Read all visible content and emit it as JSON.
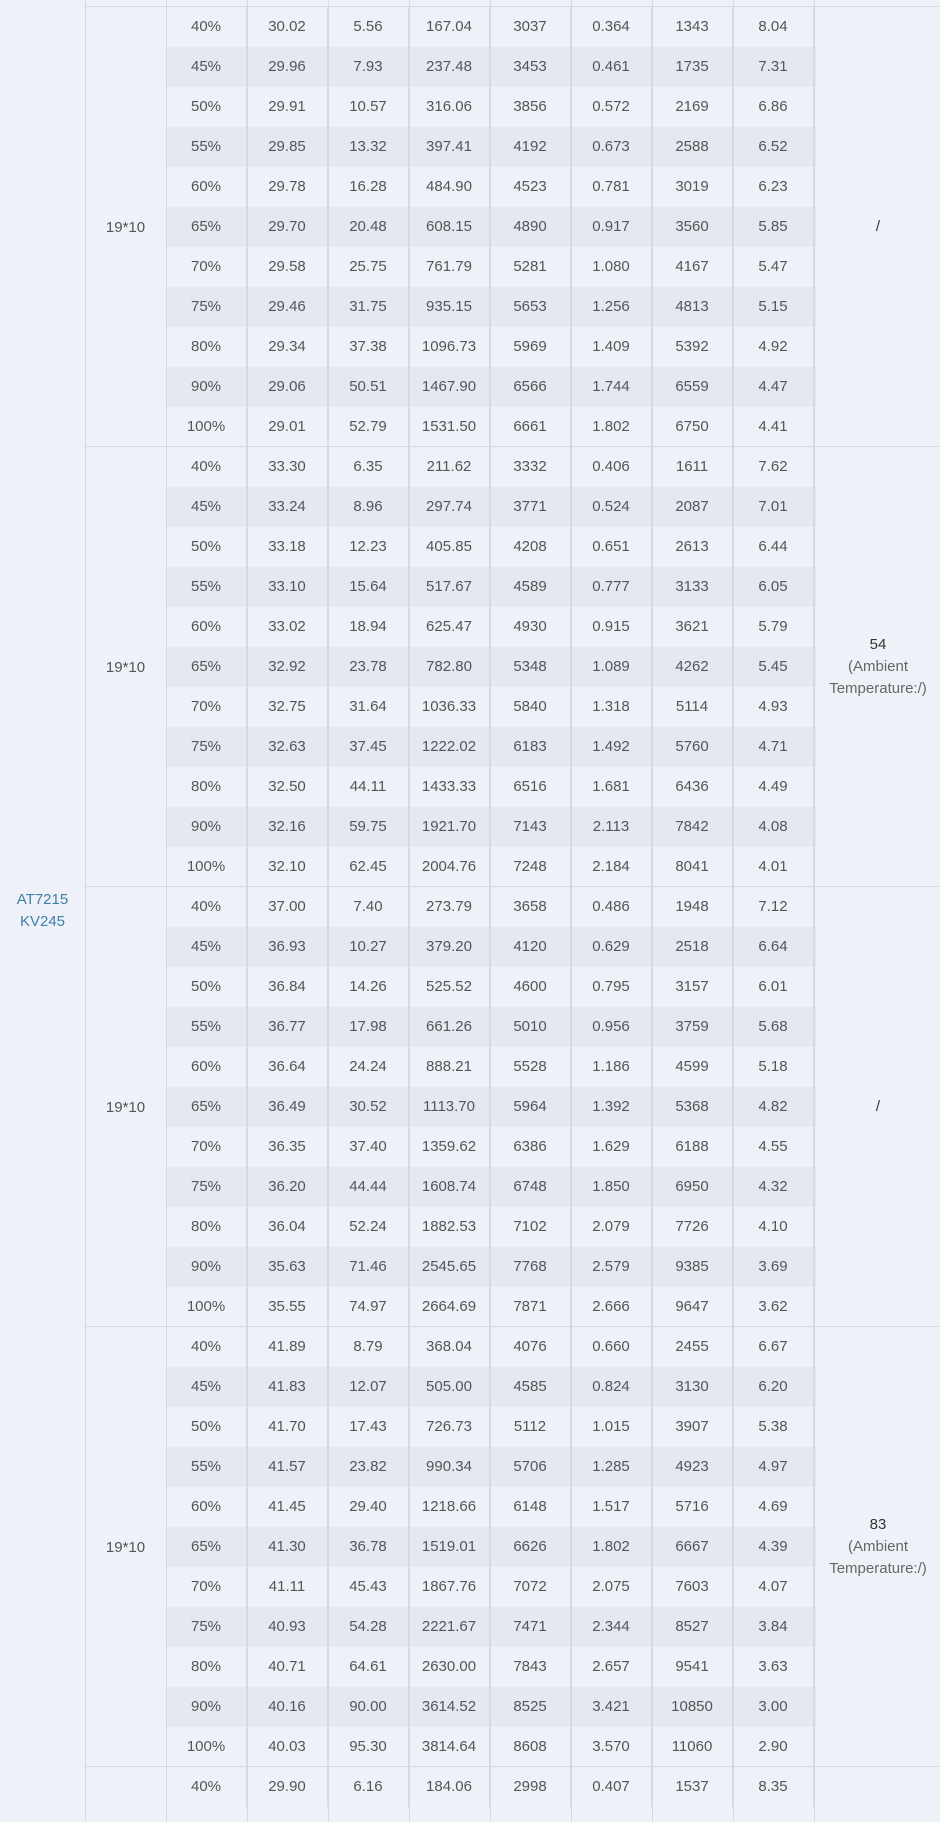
{
  "model": {
    "line1": "AT7215",
    "line2": "KV245"
  },
  "groups": [
    {
      "size": "19*10",
      "note": {
        "value": "/",
        "sub": ""
      },
      "rows": [
        [
          "40%",
          "30.02",
          "5.56",
          "167.04",
          "3037",
          "0.364",
          "1343",
          "8.04"
        ],
        [
          "45%",
          "29.96",
          "7.93",
          "237.48",
          "3453",
          "0.461",
          "1735",
          "7.31"
        ],
        [
          "50%",
          "29.91",
          "10.57",
          "316.06",
          "3856",
          "0.572",
          "2169",
          "6.86"
        ],
        [
          "55%",
          "29.85",
          "13.32",
          "397.41",
          "4192",
          "0.673",
          "2588",
          "6.52"
        ],
        [
          "60%",
          "29.78",
          "16.28",
          "484.90",
          "4523",
          "0.781",
          "3019",
          "6.23"
        ],
        [
          "65%",
          "29.70",
          "20.48",
          "608.15",
          "4890",
          "0.917",
          "3560",
          "5.85"
        ],
        [
          "70%",
          "29.58",
          "25.75",
          "761.79",
          "5281",
          "1.080",
          "4167",
          "5.47"
        ],
        [
          "75%",
          "29.46",
          "31.75",
          "935.15",
          "5653",
          "1.256",
          "4813",
          "5.15"
        ],
        [
          "80%",
          "29.34",
          "37.38",
          "1096.73",
          "5969",
          "1.409",
          "5392",
          "4.92"
        ],
        [
          "90%",
          "29.06",
          "50.51",
          "1467.90",
          "6566",
          "1.744",
          "6559",
          "4.47"
        ],
        [
          "100%",
          "29.01",
          "52.79",
          "1531.50",
          "6661",
          "1.802",
          "6750",
          "4.41"
        ]
      ]
    },
    {
      "size": "19*10",
      "note": {
        "value": "54",
        "sub": "(Ambient Temperature:/)"
      },
      "rows": [
        [
          "40%",
          "33.30",
          "6.35",
          "211.62",
          "3332",
          "0.406",
          "1611",
          "7.62"
        ],
        [
          "45%",
          "33.24",
          "8.96",
          "297.74",
          "3771",
          "0.524",
          "2087",
          "7.01"
        ],
        [
          "50%",
          "33.18",
          "12.23",
          "405.85",
          "4208",
          "0.651",
          "2613",
          "6.44"
        ],
        [
          "55%",
          "33.10",
          "15.64",
          "517.67",
          "4589",
          "0.777",
          "3133",
          "6.05"
        ],
        [
          "60%",
          "33.02",
          "18.94",
          "625.47",
          "4930",
          "0.915",
          "3621",
          "5.79"
        ],
        [
          "65%",
          "32.92",
          "23.78",
          "782.80",
          "5348",
          "1.089",
          "4262",
          "5.45"
        ],
        [
          "70%",
          "32.75",
          "31.64",
          "1036.33",
          "5840",
          "1.318",
          "5114",
          "4.93"
        ],
        [
          "75%",
          "32.63",
          "37.45",
          "1222.02",
          "6183",
          "1.492",
          "5760",
          "4.71"
        ],
        [
          "80%",
          "32.50",
          "44.11",
          "1433.33",
          "6516",
          "1.681",
          "6436",
          "4.49"
        ],
        [
          "90%",
          "32.16",
          "59.75",
          "1921.70",
          "7143",
          "2.113",
          "7842",
          "4.08"
        ],
        [
          "100%",
          "32.10",
          "62.45",
          "2004.76",
          "7248",
          "2.184",
          "8041",
          "4.01"
        ]
      ]
    },
    {
      "size": "19*10",
      "note": {
        "value": "/",
        "sub": ""
      },
      "rows": [
        [
          "40%",
          "37.00",
          "7.40",
          "273.79",
          "3658",
          "0.486",
          "1948",
          "7.12"
        ],
        [
          "45%",
          "36.93",
          "10.27",
          "379.20",
          "4120",
          "0.629",
          "2518",
          "6.64"
        ],
        [
          "50%",
          "36.84",
          "14.26",
          "525.52",
          "4600",
          "0.795",
          "3157",
          "6.01"
        ],
        [
          "55%",
          "36.77",
          "17.98",
          "661.26",
          "5010",
          "0.956",
          "3759",
          "5.68"
        ],
        [
          "60%",
          "36.64",
          "24.24",
          "888.21",
          "5528",
          "1.186",
          "4599",
          "5.18"
        ],
        [
          "65%",
          "36.49",
          "30.52",
          "1113.70",
          "5964",
          "1.392",
          "5368",
          "4.82"
        ],
        [
          "70%",
          "36.35",
          "37.40",
          "1359.62",
          "6386",
          "1.629",
          "6188",
          "4.55"
        ],
        [
          "75%",
          "36.20",
          "44.44",
          "1608.74",
          "6748",
          "1.850",
          "6950",
          "4.32"
        ],
        [
          "80%",
          "36.04",
          "52.24",
          "1882.53",
          "7102",
          "2.079",
          "7726",
          "4.10"
        ],
        [
          "90%",
          "35.63",
          "71.46",
          "2545.65",
          "7768",
          "2.579",
          "9385",
          "3.69"
        ],
        [
          "100%",
          "35.55",
          "74.97",
          "2664.69",
          "7871",
          "2.666",
          "9647",
          "3.62"
        ]
      ]
    },
    {
      "size": "19*10",
      "note": {
        "value": "83",
        "sub": "(Ambient Temperature:/)"
      },
      "rows": [
        [
          "40%",
          "41.89",
          "8.79",
          "368.04",
          "4076",
          "0.660",
          "2455",
          "6.67"
        ],
        [
          "45%",
          "41.83",
          "12.07",
          "505.00",
          "4585",
          "0.824",
          "3130",
          "6.20"
        ],
        [
          "50%",
          "41.70",
          "17.43",
          "726.73",
          "5112",
          "1.015",
          "3907",
          "5.38"
        ],
        [
          "55%",
          "41.57",
          "23.82",
          "990.34",
          "5706",
          "1.285",
          "4923",
          "4.97"
        ],
        [
          "60%",
          "41.45",
          "29.40",
          "1218.66",
          "6148",
          "1.517",
          "5716",
          "4.69"
        ],
        [
          "65%",
          "41.30",
          "36.78",
          "1519.01",
          "6626",
          "1.802",
          "6667",
          "4.39"
        ],
        [
          "70%",
          "41.11",
          "45.43",
          "1867.76",
          "7072",
          "2.075",
          "7603",
          "4.07"
        ],
        [
          "75%",
          "40.93",
          "54.28",
          "2221.67",
          "7471",
          "2.344",
          "8527",
          "3.84"
        ],
        [
          "80%",
          "40.71",
          "64.61",
          "2630.00",
          "7843",
          "2.657",
          "9541",
          "3.63"
        ],
        [
          "90%",
          "40.16",
          "90.00",
          "3614.52",
          "8525",
          "3.421",
          "10850",
          "3.00"
        ],
        [
          "100%",
          "40.03",
          "95.30",
          "3814.64",
          "8608",
          "3.570",
          "11060",
          "2.90"
        ]
      ]
    },
    {
      "size": "",
      "note": {
        "value": "",
        "sub": ""
      },
      "rows": [
        [
          "40%",
          "29.90",
          "6.16",
          "184.06",
          "2998",
          "0.407",
          "1537",
          "8.35"
        ]
      ]
    }
  ]
}
